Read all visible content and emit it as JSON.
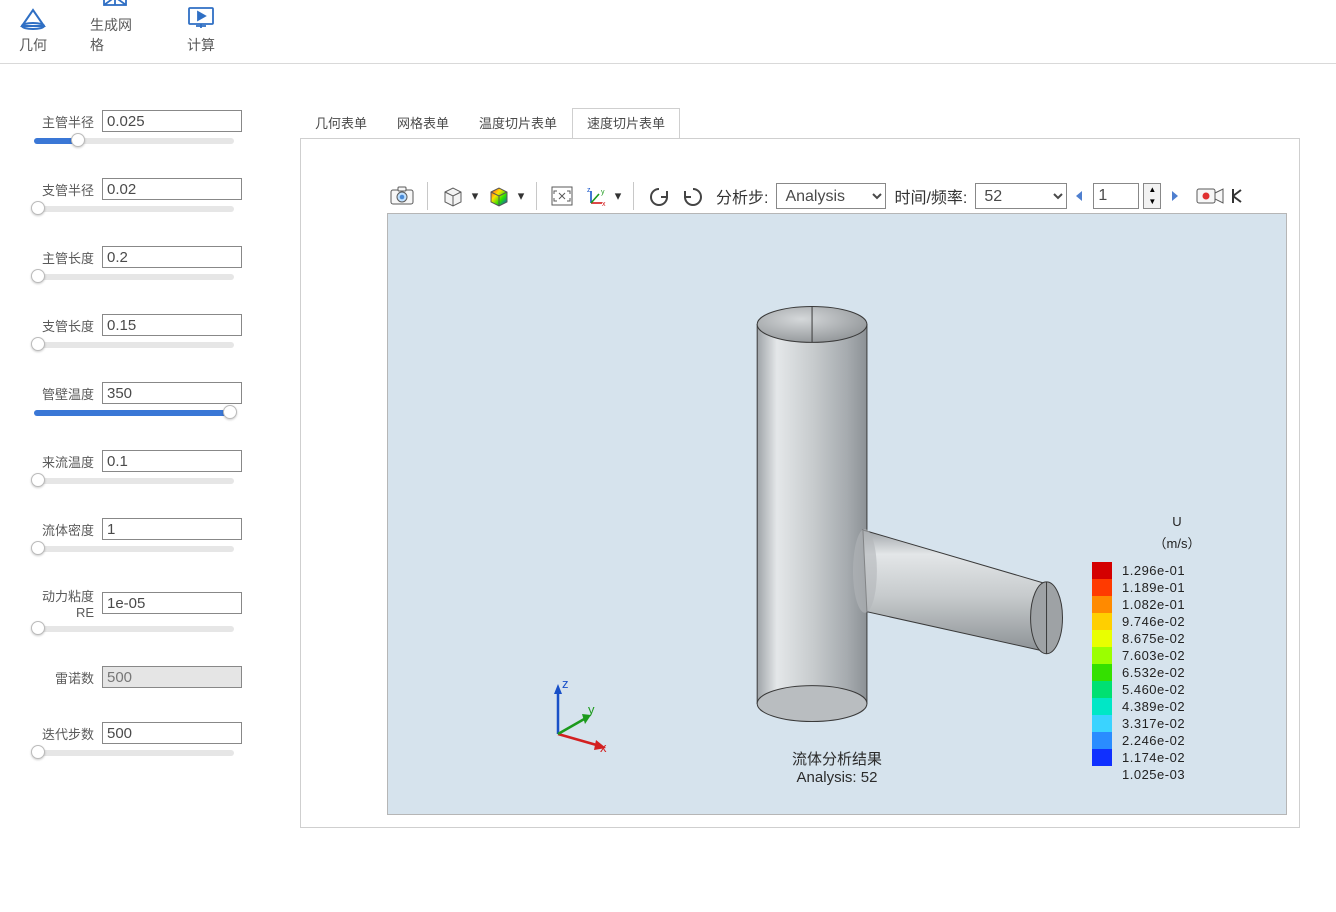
{
  "ribbon": {
    "geom": "几何",
    "mesh": "生成网格",
    "compute": "计算"
  },
  "params": {
    "main_radius": {
      "label": "主管半径",
      "value": "0.025",
      "slider_pct": 22
    },
    "branch_radius": {
      "label": "支管半径",
      "value": "0.02",
      "slider_pct": 2
    },
    "main_length": {
      "label": "主管长度",
      "value": "0.2",
      "slider_pct": 2
    },
    "branch_length": {
      "label": "支管长度",
      "value": "0.15",
      "slider_pct": 2
    },
    "wall_temp": {
      "label": "管壁温度",
      "value": "350",
      "slider_pct": 98
    },
    "inflow_temp": {
      "label": "来流温度",
      "value": "0.1",
      "slider_pct": 2
    },
    "density": {
      "label": "流体密度",
      "value": "1",
      "slider_pct": 2
    },
    "viscosity": {
      "label": "动力粘度RE",
      "value": "1e-05",
      "slider_pct": 2
    },
    "reynolds": {
      "label": "雷诺数",
      "value": "500",
      "readonly": true
    },
    "iterations": {
      "label": "迭代步数",
      "value": "500",
      "slider_pct": 2
    }
  },
  "tabs": {
    "geom": "几何表单",
    "mesh": "网格表单",
    "temp_slice": "温度切片表单",
    "vel_slice": "速度切片表单",
    "active": "vel_slice"
  },
  "vtoolbar": {
    "step_label": "分析步:",
    "step_value": "Analysis",
    "time_label": "时间/频率:",
    "time_value": "52",
    "frame_value": "1"
  },
  "caption": {
    "line1": "流体分析结果",
    "line2": "Analysis: 52"
  },
  "legend": {
    "title": "U",
    "unit": "（m/s）",
    "entries": [
      {
        "color": "#d40000",
        "val": "1.296e-01"
      },
      {
        "color": "#ff3a00",
        "val": "1.189e-01"
      },
      {
        "color": "#ff8a00",
        "val": "1.082e-01"
      },
      {
        "color": "#ffcf00",
        "val": "9.746e-02"
      },
      {
        "color": "#e9ff00",
        "val": "8.675e-02"
      },
      {
        "color": "#9bff00",
        "val": "7.603e-02"
      },
      {
        "color": "#34e000",
        "val": "6.532e-02"
      },
      {
        "color": "#00e072",
        "val": "5.460e-02"
      },
      {
        "color": "#00e7c6",
        "val": "4.389e-02"
      },
      {
        "color": "#3ad3ff",
        "val": "3.317e-02"
      },
      {
        "color": "#2a8cff",
        "val": "2.246e-02"
      },
      {
        "color": "#1030ff",
        "val": "1.174e-02"
      },
      {
        "color": "",
        "val": "1.025e-03"
      }
    ]
  },
  "triad": {
    "x": "x",
    "y": "y",
    "z": "z"
  }
}
